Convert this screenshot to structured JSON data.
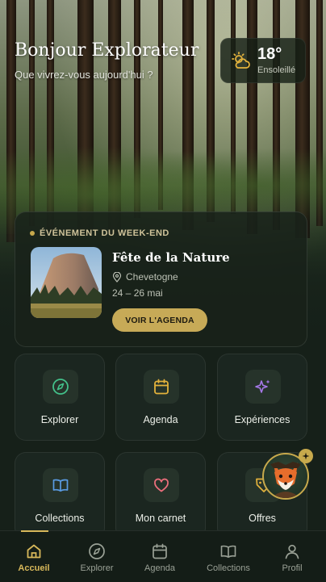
{
  "header": {
    "greeting": "Bonjour Explorateur",
    "subtitle": "Que vivrez-vous aujourd'hui ?"
  },
  "weather": {
    "temperature": "18°",
    "condition": "Ensoleillé",
    "icon": "partly-sunny-icon"
  },
  "event": {
    "tag": "ÉVÉNEMENT DU WEEK-END",
    "title": "Fête de la Nature",
    "location": "Chevetogne",
    "dates": "24 – 26 mai",
    "button_label": "VOIR L'AGENDA"
  },
  "tiles": [
    {
      "label": "Explorer",
      "icon": "compass-icon",
      "color": "#43c08a"
    },
    {
      "label": "Agenda",
      "icon": "calendar-icon",
      "color": "#e3b23c"
    },
    {
      "label": "Expériences",
      "icon": "sparkles-icon",
      "color": "#a678e8"
    },
    {
      "label": "Collections",
      "icon": "open-book-icon",
      "color": "#5a9be3"
    },
    {
      "label": "Mon carnet",
      "icon": "heart-icon",
      "color": "#ec6e7c"
    },
    {
      "label": "Offres",
      "icon": "tag-icon",
      "color": "#e3b23c"
    }
  ],
  "nav": {
    "items": [
      {
        "label": "Accueil",
        "icon": "home-icon"
      },
      {
        "label": "Explorer",
        "icon": "compass-icon"
      },
      {
        "label": "Agenda",
        "icon": "calendar-icon"
      },
      {
        "label": "Collections",
        "icon": "open-book-icon"
      },
      {
        "label": "Profil",
        "icon": "user-icon"
      }
    ],
    "active": "Accueil"
  },
  "colors": {
    "accent": "#c7aa57",
    "background": "#162019"
  }
}
